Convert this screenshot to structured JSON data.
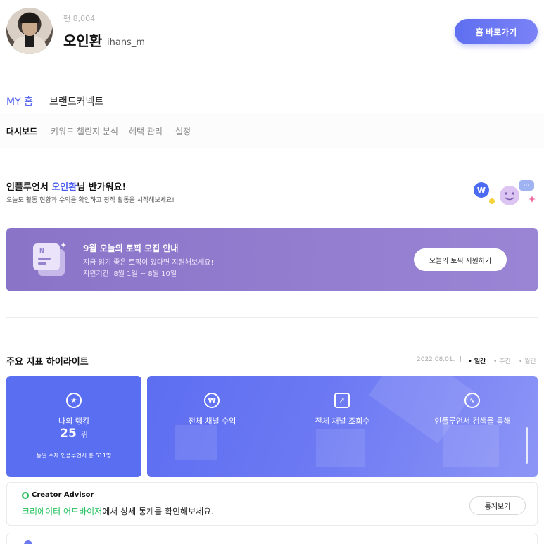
{
  "profile": {
    "fans": "팬 8,004",
    "name": "오인환",
    "handle": "ihans_m",
    "home_button": "홈 바로가기"
  },
  "tabs": [
    {
      "label": "MY 홈",
      "active": true
    },
    {
      "label": "브랜드커넥트",
      "active": false
    }
  ],
  "subnav": [
    {
      "label": "대시보드",
      "active": true
    },
    {
      "label": "키워드 챌린지 분석",
      "active": false
    },
    {
      "label": "혜택 관리",
      "active": false
    },
    {
      "label": "설정",
      "active": false
    }
  ],
  "welcome": {
    "prefix": "인플루언서 ",
    "name": "오인환",
    "suffix": "님 반가워요!",
    "subtitle": "오늘도 활동 현황과 수익을 확인하고 창작 활동을 시작해보세요!"
  },
  "banner": {
    "title": "9월 오늘의 토픽 모집 안내",
    "line1": "지금 읽기 좋은 토픽이 있다면 지원해보세요!",
    "line2": "지원기간: 8월 1일 ~ 8월 10일",
    "button": "오늘의 토픽 지원하기"
  },
  "highlights": {
    "title": "주요 지표 하이라이트",
    "date": "2022.08.01.",
    "periods": [
      {
        "label": "일간",
        "active": true
      },
      {
        "label": "주간",
        "active": false
      },
      {
        "label": "월간",
        "active": false
      }
    ],
    "rank": {
      "label": "나의 랭킹",
      "value": "25",
      "unit": "위",
      "sub": "동일 주제 인플루언서 총 511명"
    },
    "stats": [
      {
        "label": "전체 채널 수익",
        "icon": "won-icon"
      },
      {
        "label": "전체 채널 조회수",
        "icon": "cursor-icon"
      },
      {
        "label": "인플루언서 검색을 통해",
        "icon": "trend-icon"
      }
    ]
  },
  "advisor": {
    "logo": "Creator Advisor",
    "highlight": "크리에이터 어드바이저",
    "text": "에서 상세 통계를 확인해보세요.",
    "button": "통계보기"
  },
  "colors": {
    "accent": "#4b5cf0",
    "banner": "#8a74c8",
    "green": "#1fbf5a"
  }
}
